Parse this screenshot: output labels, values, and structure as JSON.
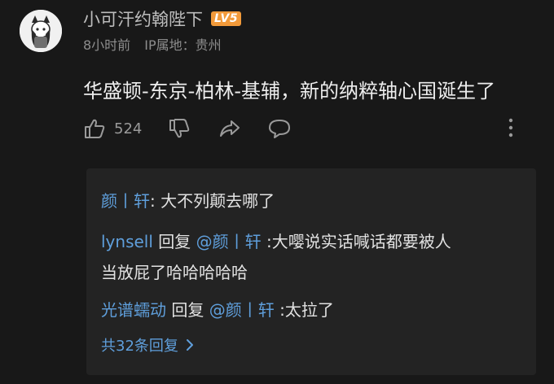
{
  "comment": {
    "username": "小可汗约翰陛下",
    "level_badge": "LV5",
    "time": "8小时前",
    "ip_location": "IP属地：贵州",
    "text": "华盛顿-东京-柏林-基辅，新的纳粹轴心国诞生了",
    "like_count": "524"
  },
  "replies": [
    {
      "author": "颜丨轩",
      "separator": ": ",
      "text": "大不列颠去哪了"
    },
    {
      "author": "lynsell",
      "action": " 回复 ",
      "mention": "@颜丨轩",
      "text": " :大嘤说实话喊话都要被人",
      "text_cont": "当放屁了哈哈哈哈哈"
    },
    {
      "author": "光谱蠕动",
      "action": " 回复 ",
      "mention": "@颜丨轩",
      "text": " :太拉了"
    }
  ],
  "more_replies_label": "共32条回复",
  "icons": [
    "avatar",
    "like-icon",
    "dislike-icon",
    "share-icon",
    "comment-icon",
    "more-vertical-icon",
    "chevron-right-icon"
  ]
}
